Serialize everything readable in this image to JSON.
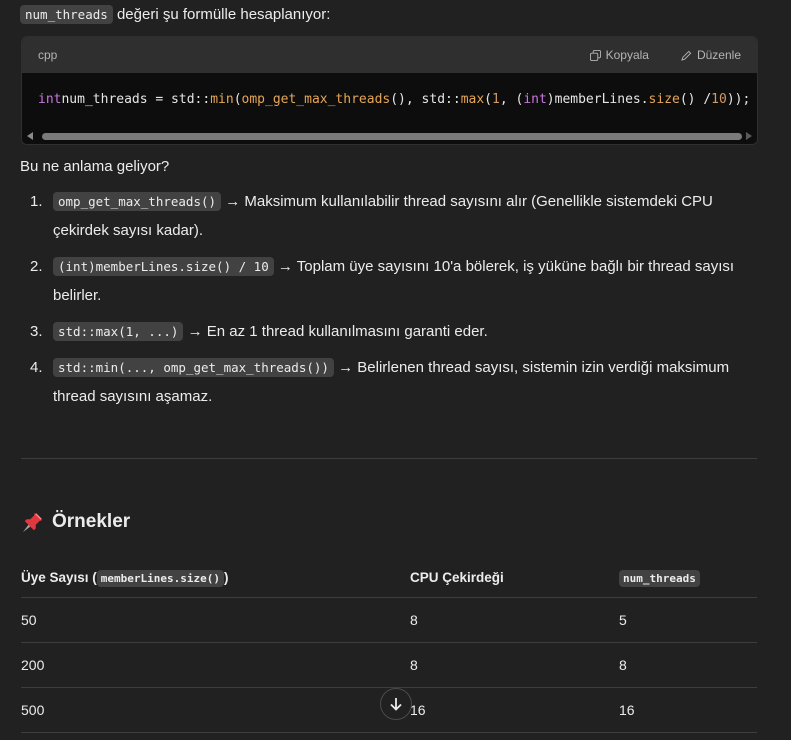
{
  "intro": {
    "code": "num_threads",
    "text": " değeri şu formülle hesaplanıyor:"
  },
  "codeblock": {
    "lang": "cpp",
    "copy_label": "Kopyala",
    "edit_label": "Düzenle",
    "tokens": [
      {
        "t": "int",
        "c": "kw"
      },
      {
        "t": " num_threads = std::",
        "c": ""
      },
      {
        "t": "min",
        "c": "fn"
      },
      {
        "t": "(",
        "c": ""
      },
      {
        "t": "omp_get_max_threads",
        "c": "fn"
      },
      {
        "t": "(), std::",
        "c": ""
      },
      {
        "t": "max",
        "c": "fn"
      },
      {
        "t": "(",
        "c": ""
      },
      {
        "t": "1",
        "c": "num"
      },
      {
        "t": ", (",
        "c": ""
      },
      {
        "t": "int",
        "c": "kw"
      },
      {
        "t": ")memberLines.",
        "c": ""
      },
      {
        "t": "size",
        "c": "fn"
      },
      {
        "t": "() / ",
        "c": ""
      },
      {
        "t": "10",
        "c": "num"
      },
      {
        "t": "));",
        "c": ""
      }
    ]
  },
  "question": "Bu ne anlama geliyor?",
  "items": [
    {
      "num": "1.",
      "code": "omp_get_max_threads()",
      "text": " → Maksimum kullanılabilir thread sayısını alır (Genellikle sistemdeki CPU çekirdek sayısı kadar)."
    },
    {
      "num": "2.",
      "code": "(int)memberLines.size() / 10",
      "text": " → Toplam üye sayısını 10'a bölerek, iş yüküne bağlı bir thread sayısı belirler."
    },
    {
      "num": "3.",
      "code": "std::max(1, ...)",
      "text": " → En az 1 thread kullanılmasını garanti eder."
    },
    {
      "num": "4.",
      "code": "std::min(..., omp_get_max_threads())",
      "text": " → Belirlenen thread sayısı, sistemin izin verdiği maksimum thread sayısını aşamaz."
    }
  ],
  "section": {
    "icon": "pushpin-icon",
    "title": "Örnekler"
  },
  "table": {
    "headers": {
      "col1_prefix": "Üye Sayısı (",
      "col1_code": "memberLines.size()",
      "col1_suffix": ")",
      "col2": "CPU Çekirdeği",
      "col3": "num_threads"
    },
    "rows": [
      {
        "a": "50",
        "b": "8",
        "c": "5"
      },
      {
        "a": "200",
        "b": "8",
        "c": "8"
      },
      {
        "a": "500",
        "b": "16",
        "c": "16"
      }
    ]
  },
  "scroll_button_icon": "arrow-down-icon"
}
